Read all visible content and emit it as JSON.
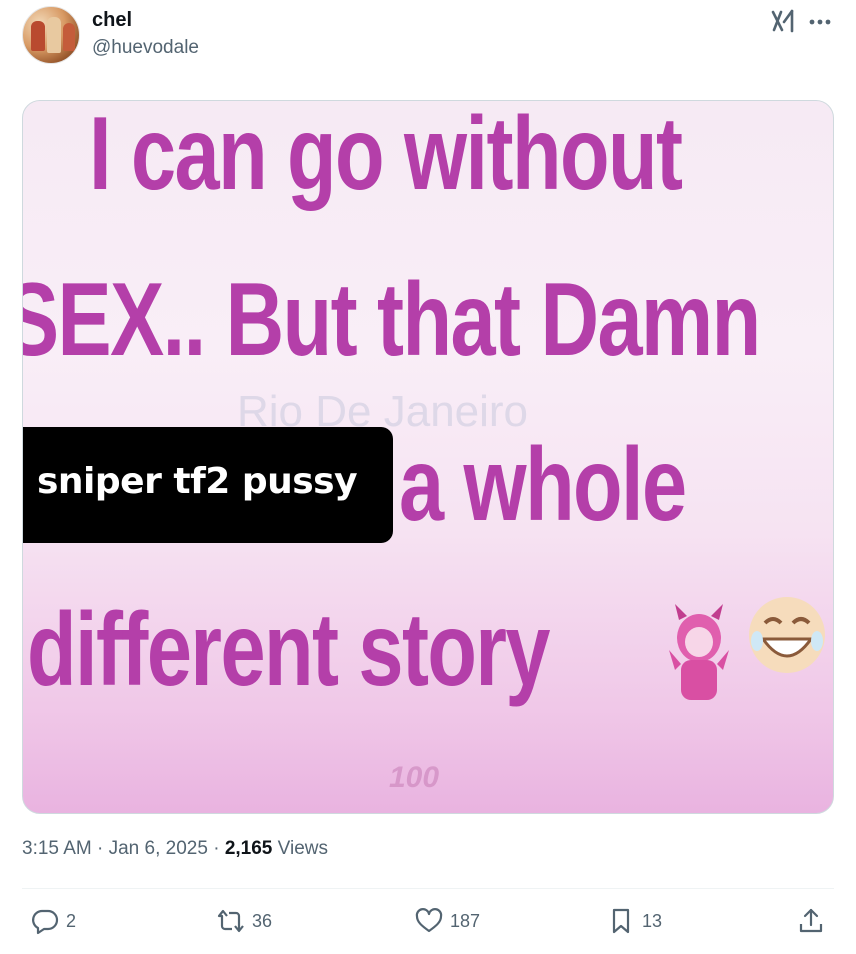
{
  "author": {
    "display_name": "chel",
    "handle": "@huevodale"
  },
  "icons": {
    "grok": "grok-icon",
    "more": "more-icon",
    "reply": "reply-icon",
    "repost": "repost-icon",
    "like": "like-icon",
    "bookmark": "bookmark-icon",
    "share": "share-icon"
  },
  "media": {
    "meme_lines": [
      "I can go without",
      "SEX.. But that Damn",
      "a whole",
      "different story"
    ],
    "watermark": "Rio De Janeiro",
    "corner_number": "100",
    "caption": "sniper tf2 pussy"
  },
  "meta": {
    "time": "3:15 AM",
    "separator": "·",
    "date": "Jan 6, 2025",
    "views_count": "2,165",
    "views_label": "Views"
  },
  "actions": {
    "replies": "2",
    "reposts": "36",
    "likes": "187",
    "bookmarks": "13"
  },
  "colors": {
    "meme_text": "#b43fa9",
    "secondary_text": "#536471",
    "primary_text": "#0f1419"
  }
}
